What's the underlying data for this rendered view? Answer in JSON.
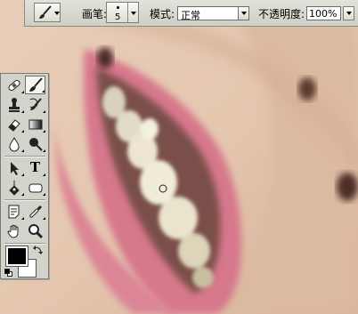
{
  "options_bar": {
    "brush_label": "画笔:",
    "brush_size": "5",
    "mode_label": "模式:",
    "mode_value": "正常",
    "opacity_label": "不透明度:",
    "opacity_value": "100%"
  },
  "toolbox": {
    "active_tool": "brush",
    "type_tool_glyph": "T",
    "foreground_color": "#000000",
    "background_color": "#ffffff"
  },
  "cursor": {
    "shape": "brush-circle"
  }
}
